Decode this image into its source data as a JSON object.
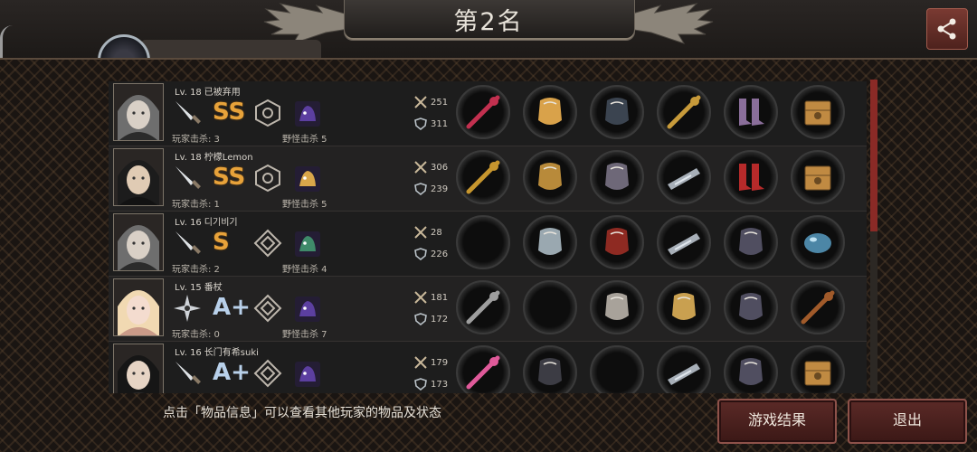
{
  "header": {
    "rank_title": "第2名",
    "share_icon": "share-icon"
  },
  "players": [
    {
      "level": "Lv. 18",
      "name": "已被弃用",
      "weapon_icon": "dagger-icon",
      "grade": "SS",
      "grade_color": "gold",
      "skill_icon": "hexagon-skill-icon",
      "pet_icon": "purple-beast-pet-icon",
      "player_kills": "玩家击杀: 3",
      "monster_kills": "野怪击杀 5",
      "attack": "251",
      "defense": "311",
      "items": [
        "crimson-blade-icon",
        "golden-tiara-icon",
        "dark-armor-icon",
        "golden-staff-icon",
        "purple-boots-icon",
        "supply-crate-icon"
      ]
    },
    {
      "level": "Lv. 18",
      "name": "柠檬Lemon",
      "weapon_icon": "dagger-icon",
      "grade": "SS",
      "grade_color": "gold",
      "skill_icon": "hexagon-skill-icon",
      "pet_icon": "golden-box-pet-icon",
      "player_kills": "玩家击杀: 1",
      "monster_kills": "野怪击杀 5",
      "attack": "306",
      "defense": "239",
      "items": [
        "golden-scepter-icon",
        "gold-helmet-icon",
        "steel-armor-icon",
        "metal-bracer-icon",
        "red-heels-icon",
        "supply-crate-icon"
      ]
    },
    {
      "level": "Lv. 16",
      "name": "디기비기",
      "weapon_icon": "dagger-icon",
      "grade": "S",
      "grade_color": "gold",
      "skill_icon": "diamond-skill-icon",
      "pet_icon": "green-spirit-pet-icon",
      "player_kills": "玩家击杀: 2",
      "monster_kills": "野怪击杀 4",
      "attack": "28",
      "defense": "226",
      "items": [
        "empty-slot-icon",
        "steel-helmet-icon",
        "red-armor-icon",
        "metal-bracer-icon",
        "dark-gauntlet-icon",
        "blue-orb-icon"
      ]
    },
    {
      "level": "Lv. 15",
      "name": "番杖",
      "weapon_icon": "shuriken-icon",
      "grade": "A+",
      "grade_color": "blue",
      "skill_icon": "diamond-skill-icon",
      "pet_icon": "purple-beast-pet-icon",
      "player_kills": "玩家击杀: 0",
      "monster_kills": "野怪击杀 7",
      "attack": "181",
      "defense": "172",
      "items": [
        "scythe-icon",
        "empty-slot-icon",
        "plate-armor-icon",
        "golden-shield-icon",
        "dark-gauntlet-icon",
        "wooden-cross-icon"
      ]
    },
    {
      "level": "Lv. 16",
      "name": "长门有希suki",
      "weapon_icon": "dagger-icon",
      "grade": "A+",
      "grade_color": "blue",
      "skill_icon": "diamond-skill-icon",
      "pet_icon": "purple-beast-pet-icon",
      "player_kills": "",
      "monster_kills": "",
      "attack": "179",
      "defense": "173",
      "items": [
        "pink-halberd-icon",
        "dark-helmet-icon",
        "empty-slot-icon",
        "metal-bracer-icon",
        "dark-gauntlet-icon",
        "supply-crate-icon"
      ]
    }
  ],
  "footer": {
    "hint": "点击「物品信息」可以查看其他玩家的物品及状态",
    "result_button": "游戏结果",
    "exit_button": "退出"
  },
  "colors": {
    "accent_red": "#8a2a26",
    "grade_gold": "#e7a23a",
    "grade_blue": "#b8d0ea"
  }
}
